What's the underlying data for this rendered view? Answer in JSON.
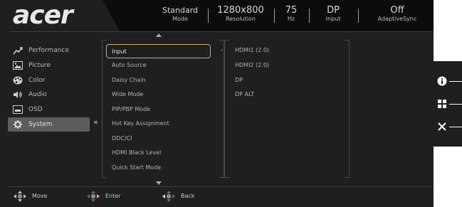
{
  "header": {
    "logo": "acer",
    "stats": [
      {
        "value": "Standard",
        "label": "Mode"
      },
      {
        "value": "1280x800",
        "label": "Resolution"
      },
      {
        "value": "75",
        "label": "Hz"
      },
      {
        "value": "DP",
        "label": "Input"
      },
      {
        "value": "Off",
        "label": "AdaptiveSync"
      }
    ]
  },
  "sidebar": {
    "items": [
      {
        "label": "Performance",
        "icon": "performance-icon"
      },
      {
        "label": "Picture",
        "icon": "picture-icon"
      },
      {
        "label": "Color",
        "icon": "color-palette-icon"
      },
      {
        "label": "Audio",
        "icon": "speaker-icon"
      },
      {
        "label": "OSD",
        "icon": "osd-icon"
      },
      {
        "label": "System",
        "icon": "gear-icon",
        "active": true
      }
    ]
  },
  "menu": {
    "items": [
      "Input",
      "Auto Source",
      "Daisy Chain",
      "Wide Mode",
      "PIP/PBP Mode",
      "Hot Key Assignment",
      "DDC/CI",
      "HDMI Black Level",
      "Quick Start Mode"
    ],
    "selected": "Input"
  },
  "input_options": [
    "HDMI1 (2.0)",
    "HDMI2 (2.0)",
    "DP",
    "DP ALT"
  ],
  "footer": {
    "move": "Move",
    "enter": "Enter",
    "back": "Back"
  },
  "hotkeys": [
    "info-icon",
    "grid-icon",
    "close-icon"
  ],
  "colors": {
    "background": "#1f1f1f",
    "header_bar": "#0c0c0c",
    "active_sidebar": "#5d5d5d",
    "selection_border": "#c9a96e",
    "text": "#b9b9b9"
  }
}
